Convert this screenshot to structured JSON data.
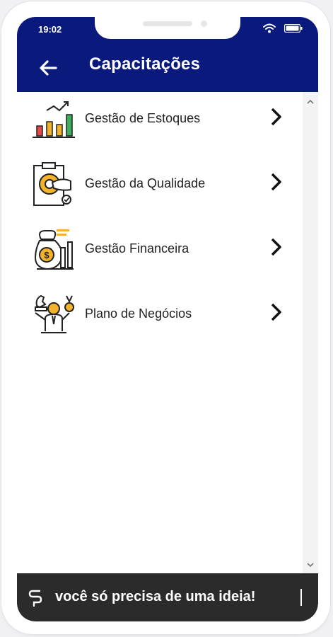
{
  "status_bar": {
    "time": "19:02",
    "icons": [
      "wifi-icon",
      "battery-icon"
    ]
  },
  "app_bar": {
    "title": "Capacitações",
    "back_icon": "arrow-left-icon"
  },
  "list": {
    "items": [
      {
        "label": "Gestão de Estoques",
        "icon": "bar-chart-growth-icon"
      },
      {
        "label": "Gestão da Qualidade",
        "icon": "quality-gear-clipboard-icon"
      },
      {
        "label": "Gestão Financeira",
        "icon": "money-bag-chart-icon"
      },
      {
        "label": "Plano de Negócios",
        "icon": "strategy-chess-person-icon"
      }
    ],
    "chevron_icon": "chevron-right-icon"
  },
  "banner": {
    "slogan": "você só precisa de uma ideia!"
  },
  "colors": {
    "primary": "#0a1a7c",
    "accent": "#f2b32a",
    "banner": "#2b2b2b"
  }
}
